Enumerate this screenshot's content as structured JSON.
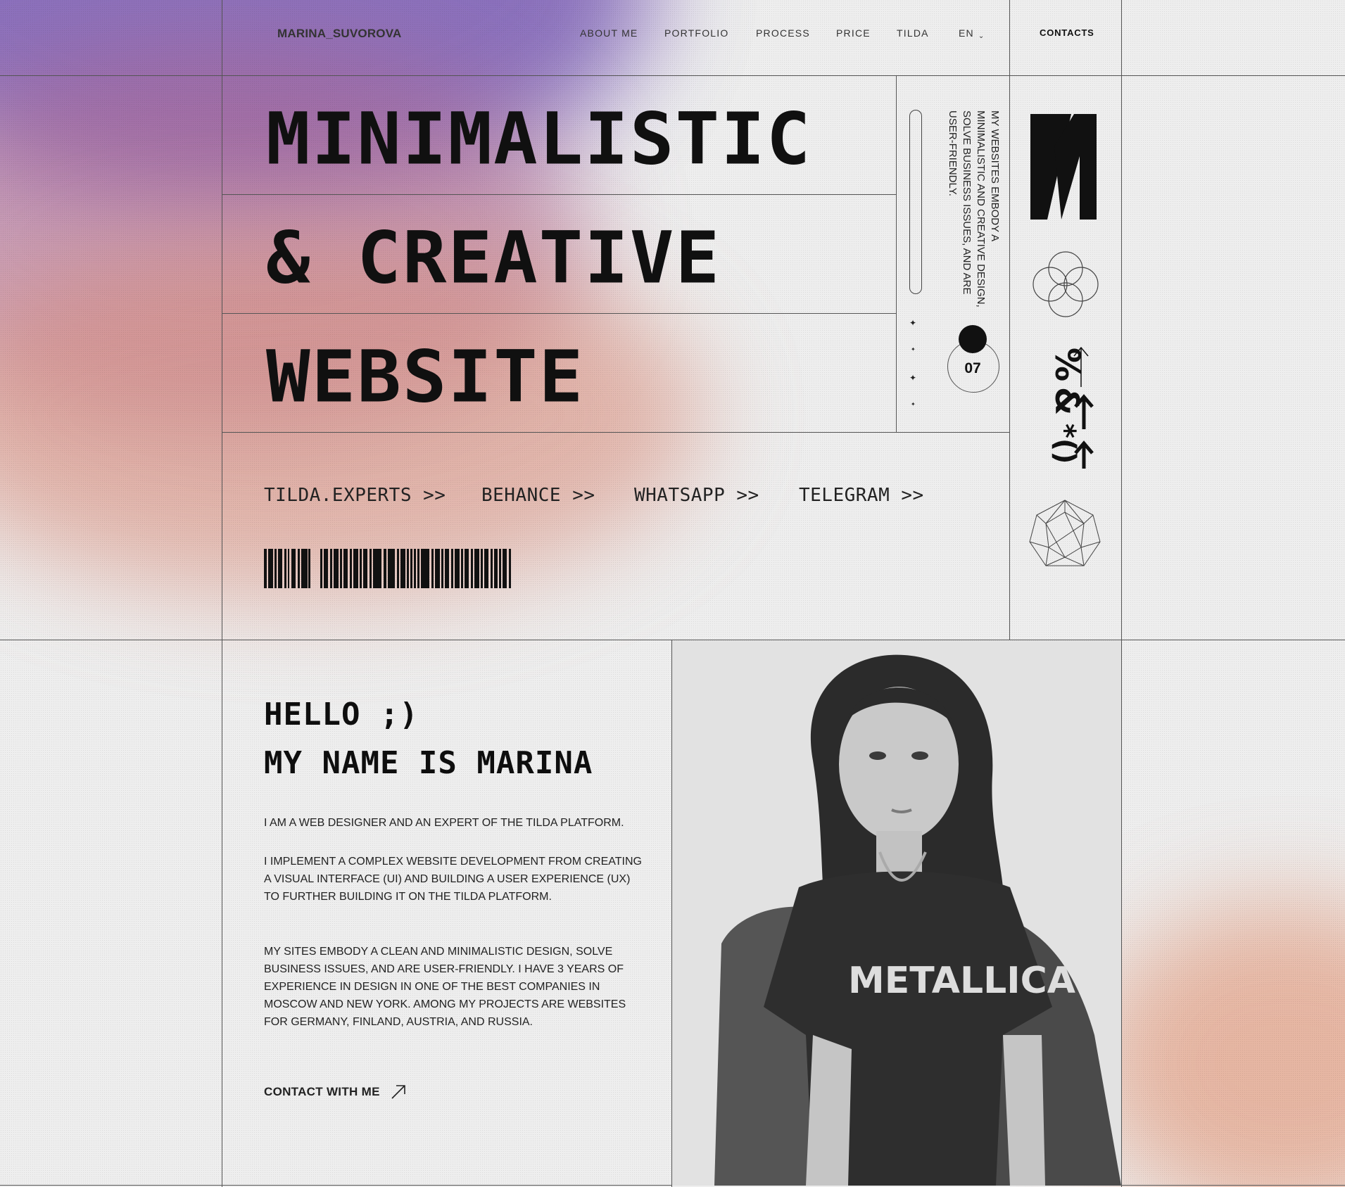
{
  "header": {
    "logo": "MARINA_SUVOROVA",
    "nav": [
      "ABOUT ME",
      "PORTFOLIO",
      "PROCESS",
      "PRICE",
      "TILDA"
    ],
    "language": "EN",
    "contacts": "CONTACTS"
  },
  "hero": {
    "line1": "MINIMALISTIC",
    "line2": "& CREATIVE",
    "line3": "WEBSITE",
    "side_text": "MY WEBSITES EMBODY A MINIMALISTIC AND CREATIVE DESIGN, SOLVE BUSINESS ISSUES, AND ARE USER-FRIENDLY.",
    "counter": "07",
    "links": [
      "TILDA.EXPERTS >>",
      "BEHANCE >>",
      "WHATSAPP >>",
      "TELEGRAM >>"
    ]
  },
  "about": {
    "greeting": "HELLO ;)",
    "name_line": "MY NAME IS MARINA",
    "p1": "I AM A WEB DESIGNER AND AN EXPERT OF THE TILDA PLATFORM.",
    "p2": "I IMPLEMENT A COMPLEX WEBSITE DEVELOPMENT FROM CREATING A VISUAL INTERFACE (UI) AND BUILDING A USER EXPERIENCE (UX) TO FURTHER BUILDING IT ON THE TILDA PLATFORM.",
    "p3": "MY SITES EMBODY A CLEAN AND MINIMALISTIC DESIGN, SOLVE BUSINESS ISSUES, AND ARE USER-FRIENDLY. I HAVE 3 YEARS OF EXPERIENCE IN DESIGN IN ONE OF THE BEST COMPANIES IN MOSCOW AND NEW YORK. AMONG MY PROJECTS ARE WEBSITES FOR GERMANY, FINLAND, AUSTRIA, AND RUSSIA.",
    "cta": "CONTACT WITH ME",
    "shirt_text": "METALLICA"
  },
  "icons": [
    "m-logo-icon",
    "interlocking-circles-icon",
    "percent-arrows-icon",
    "geodesic-sphere-icon",
    "arrow-up-right-icon",
    "chevron-down-icon"
  ],
  "colors": {
    "violet": "#7a5cb5",
    "peach": "#d98f7e",
    "background": "#eeeeee",
    "ink": "#111111"
  }
}
